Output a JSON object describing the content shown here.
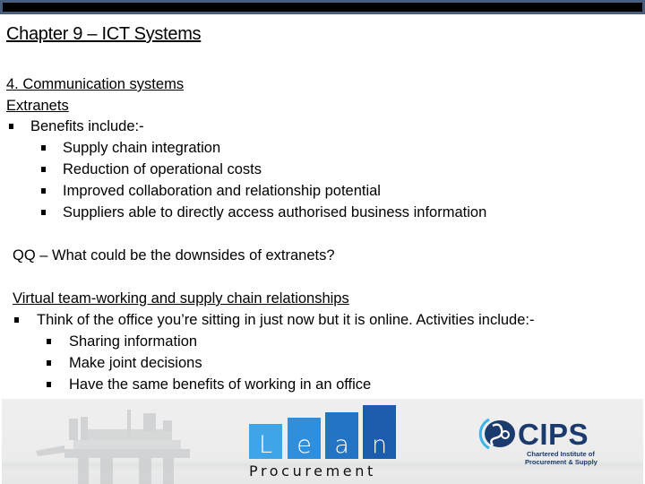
{
  "slide": {
    "title": "Chapter 9 – ICT Systems",
    "section1": {
      "heading": "4. Communication systems",
      "subheading": "Extranets",
      "bullet": "Benefits include:-",
      "subbullets": [
        "Supply chain integration",
        "Reduction of operational costs",
        "Improved collaboration and relationship potential",
        "Suppliers able to directly access authorised business information"
      ]
    },
    "question": "QQ – What could be the downsides of extranets?",
    "section2": {
      "heading": "Virtual team-working and supply chain relationships",
      "bullet": "Think of the office you’re sitting in just now but it is online. Activities include:-",
      "subbullets": [
        "Sharing information",
        "Make joint decisions",
        "Have the same benefits of working in an office"
      ]
    }
  },
  "footer": {
    "lean_logo": {
      "letters": [
        "L",
        "e",
        "a",
        "n"
      ],
      "subtitle": "Procurement",
      "colors": [
        "#3fa4e8",
        "#2f8fdc",
        "#2474c6",
        "#1c5cad"
      ]
    },
    "cips_logo": {
      "name": "CIPS",
      "line1": "Chartered Institute of",
      "line2": "Procurement & Supply",
      "color": "#1b3a6d",
      "accent": "#3cb4e6"
    }
  }
}
